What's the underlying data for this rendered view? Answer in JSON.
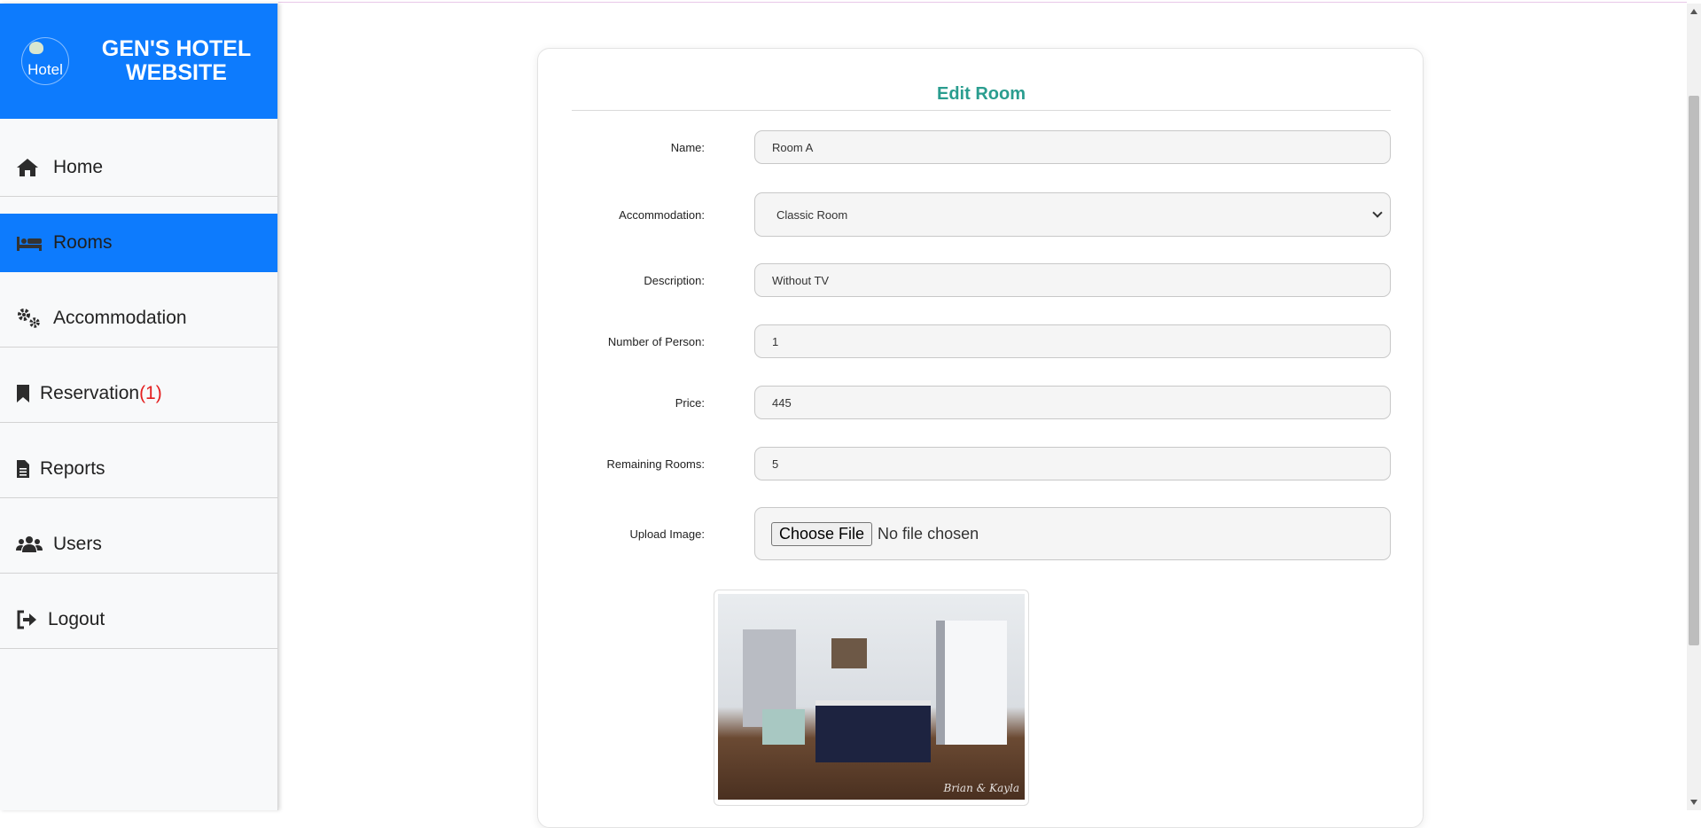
{
  "brand": {
    "logo_alt": "Hotel",
    "title_line1": "GEN'S HOTEL",
    "title_line2": "WEBSITE"
  },
  "sidebar": {
    "items": [
      {
        "label": "Home",
        "icon": "home-icon",
        "active": false
      },
      {
        "label": "Rooms",
        "icon": "bed-icon",
        "active": true
      },
      {
        "label": "Accommodation",
        "icon": "gears-icon",
        "active": false
      },
      {
        "label": "Reservation",
        "count": "(1)",
        "icon": "bookmark-icon",
        "active": false
      },
      {
        "label": "Reports",
        "icon": "file-icon",
        "active": false
      },
      {
        "label": "Users",
        "icon": "users-icon",
        "active": false
      },
      {
        "label": "Logout",
        "icon": "logout-icon",
        "active": false
      }
    ]
  },
  "form": {
    "title": "Edit Room",
    "name_label": "Name:",
    "name_value": "Room A",
    "accommodation_label": "Accommodation:",
    "accommodation_value": "Classic Room",
    "description_label": "Description:",
    "description_value": "Without TV",
    "persons_label": "Number of Person:",
    "persons_value": "1",
    "price_label": "Price:",
    "price_value": "445",
    "remaining_label": "Remaining Rooms:",
    "remaining_value": "5",
    "upload_label": "Upload Image:",
    "choose_file": "Choose File",
    "no_file": "No file chosen",
    "photo_watermark": "Brian & Kayla"
  },
  "colors": {
    "accent": "#0d7bfd",
    "title": "#2a9d8f",
    "badge": "#e41e1e"
  }
}
